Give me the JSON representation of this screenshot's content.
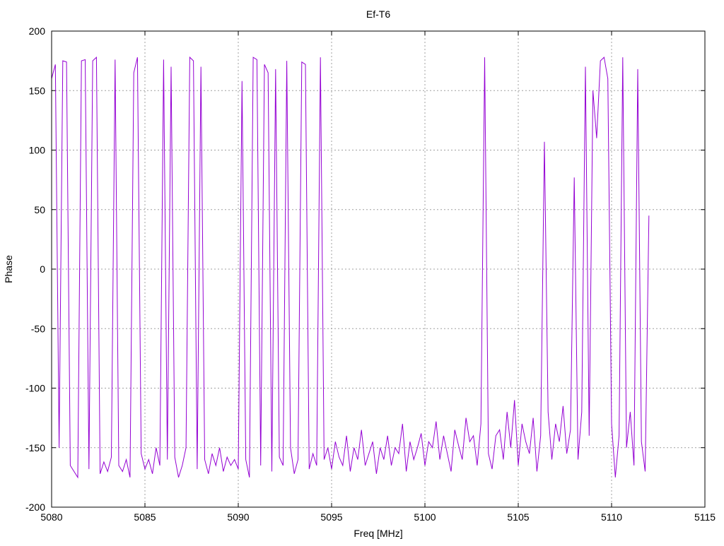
{
  "chart_data": {
    "type": "line",
    "title": "Ef-T6",
    "xlabel": "Freq [MHz]",
    "ylabel": "Phase",
    "xlim": [
      5080,
      5115
    ],
    "ylim": [
      -200,
      200
    ],
    "xticks": [
      5080,
      5085,
      5090,
      5095,
      5100,
      5105,
      5110,
      5115
    ],
    "yticks": [
      -200,
      -150,
      -100,
      -50,
      0,
      50,
      100,
      150,
      200
    ],
    "grid": true,
    "legend": "none",
    "color": "#9400d3",
    "series": [
      {
        "name": "Phase",
        "x_start": 5080,
        "x_step": 0.2,
        "values": [
          160,
          172,
          -150,
          175,
          174,
          -165,
          -170,
          -175,
          175,
          176,
          -168,
          175,
          178,
          -172,
          -162,
          -170,
          -158,
          176,
          -165,
          -170,
          -160,
          -175,
          165,
          178,
          -155,
          -168,
          -160,
          -172,
          -150,
          -165,
          176,
          -160,
          170,
          -158,
          -175,
          -165,
          -150,
          178,
          175,
          -168,
          170,
          -160,
          -172,
          -155,
          -165,
          -150,
          -170,
          -158,
          -165,
          -160,
          -168,
          158,
          -160,
          -175,
          178,
          176,
          -165,
          172,
          165,
          -170,
          168,
          -158,
          -165,
          175,
          -150,
          -172,
          -160,
          174,
          172,
          -168,
          -155,
          -165,
          178,
          -160,
          -150,
          -168,
          -145,
          -158,
          -165,
          -140,
          -170,
          -150,
          -160,
          -135,
          -165,
          -155,
          -145,
          -172,
          -150,
          -160,
          -140,
          -165,
          -150,
          -155,
          -130,
          -170,
          -145,
          -160,
          -150,
          -138,
          -165,
          -145,
          -150,
          -128,
          -160,
          -140,
          -155,
          -170,
          -135,
          -148,
          -160,
          -125,
          -145,
          -140,
          -165,
          -130,
          178,
          -155,
          -168,
          -140,
          -135,
          -160,
          -120,
          -150,
          -110,
          -165,
          -130,
          -145,
          -155,
          -125,
          -170,
          -140,
          107,
          -120,
          -160,
          -130,
          -145,
          -115,
          -155,
          -135,
          77,
          -160,
          -120,
          170,
          -140,
          150,
          110,
          175,
          178,
          160,
          -130,
          -175,
          -140,
          178,
          -150,
          -120,
          -165,
          168,
          -145,
          -170,
          45
        ]
      }
    ]
  }
}
